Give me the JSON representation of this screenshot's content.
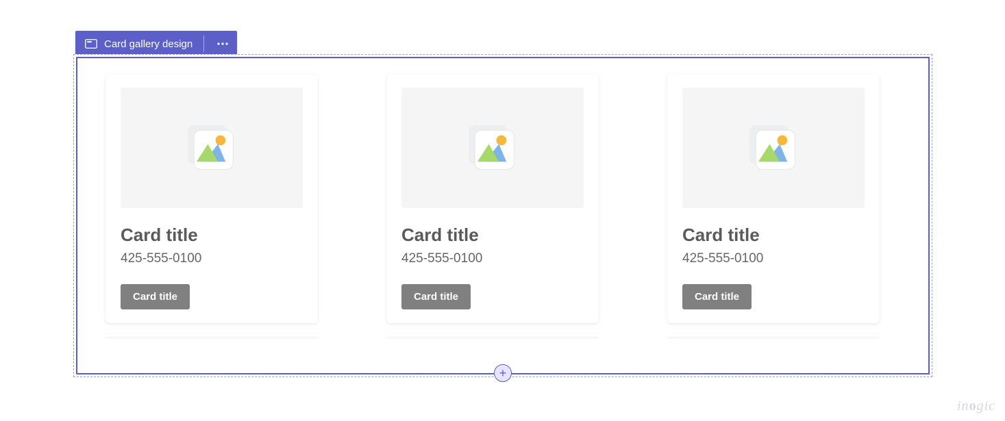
{
  "selection": {
    "icon": "card-gallery-icon",
    "label": "Card gallery design",
    "more_icon": "more-horizontal-icon"
  },
  "add_handle": {
    "icon": "plus-icon",
    "glyph": "+"
  },
  "gallery": {
    "cards": [
      {
        "title": "Card title",
        "subtitle": "425-555-0100",
        "button_label": "Card title"
      },
      {
        "title": "Card title",
        "subtitle": "425-555-0100",
        "button_label": "Card title"
      },
      {
        "title": "Card title",
        "subtitle": "425-555-0100",
        "button_label": "Card title"
      }
    ]
  },
  "watermark": {
    "text": "inogic"
  }
}
